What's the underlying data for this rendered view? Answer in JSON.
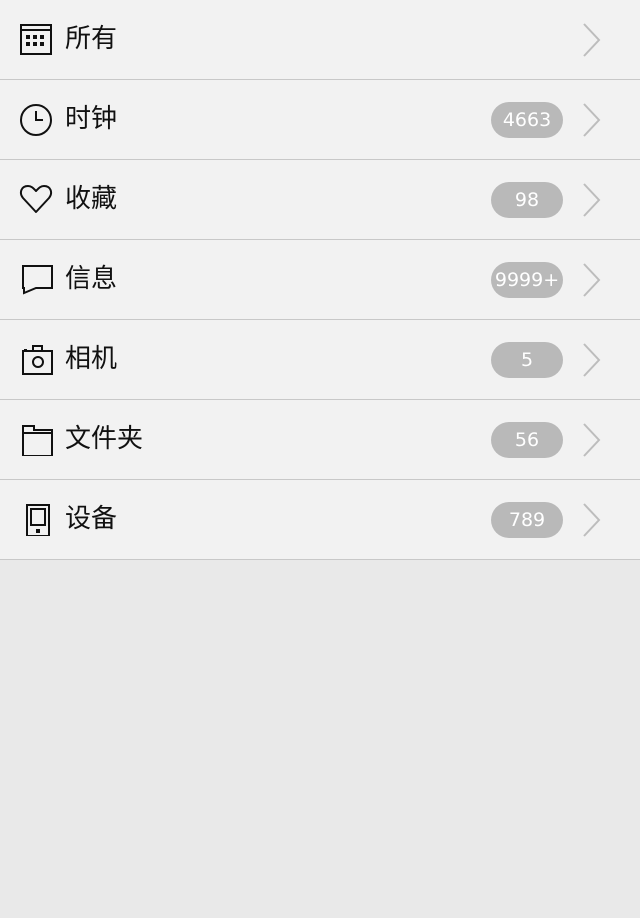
{
  "colors": {
    "row_background": "#f2f2f2",
    "divider": "#c8c8c8",
    "badge_background": "#b9b9b9",
    "badge_text": "#ffffff",
    "label_text": "#111111",
    "chevron": "#bdbdbd",
    "page_background": "#e9e9e9"
  },
  "menu": {
    "items": [
      {
        "label": "所有",
        "badge": "",
        "icon": "calendar-grid-icon"
      },
      {
        "label": "时钟",
        "badge": "4663",
        "icon": "clock-icon"
      },
      {
        "label": "收藏",
        "badge": "98",
        "icon": "heart-icon"
      },
      {
        "label": "信息",
        "badge": "9999+",
        "icon": "message-bubble-icon"
      },
      {
        "label": "相机",
        "badge": "5",
        "icon": "camera-icon"
      },
      {
        "label": "文件夹",
        "badge": "56",
        "icon": "folder-icon"
      },
      {
        "label": "设备",
        "badge": "789",
        "icon": "device-icon"
      }
    ]
  }
}
